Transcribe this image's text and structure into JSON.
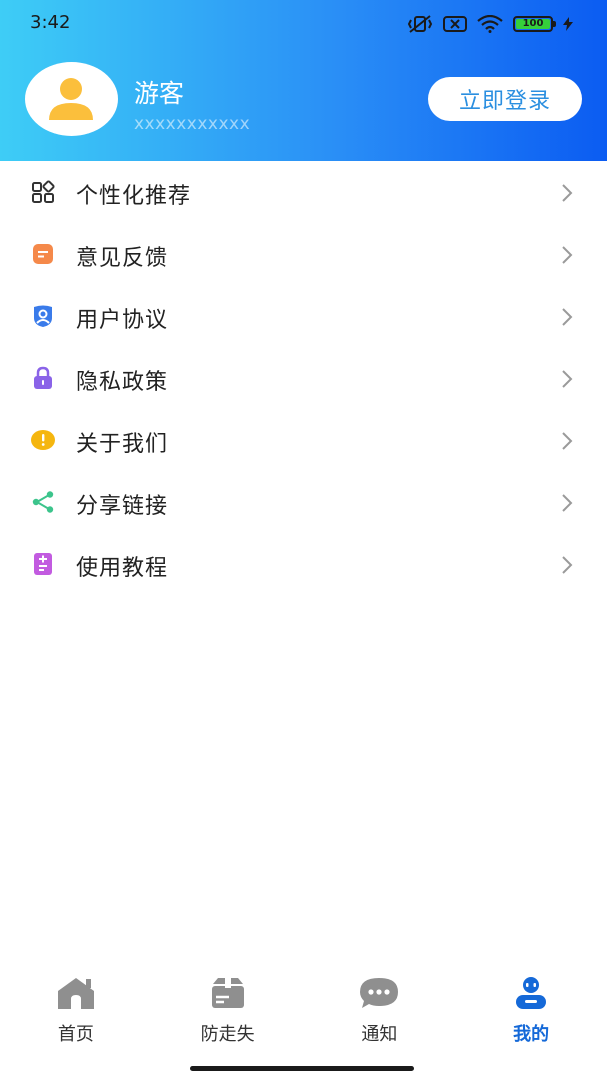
{
  "status_bar": {
    "time": "3:42",
    "battery": "100"
  },
  "profile": {
    "name": "游客",
    "id_masked": "xxxxxxxxxxx",
    "login_label": "立即登录"
  },
  "menu": [
    {
      "label": "个性化推荐",
      "icon": "grid-icon",
      "color": "#333333"
    },
    {
      "label": "意见反馈",
      "icon": "feedback-icon",
      "color": "#f5894a"
    },
    {
      "label": "用户协议",
      "icon": "user-shield-icon",
      "color": "#3a7bea"
    },
    {
      "label": "隐私政策",
      "icon": "lock-icon",
      "color": "#8a63e8"
    },
    {
      "label": "关于我们",
      "icon": "info-icon",
      "color": "#f5b60f"
    },
    {
      "label": "分享链接",
      "icon": "share-icon",
      "color": "#3cc48c"
    },
    {
      "label": "使用教程",
      "icon": "tutorial-icon",
      "color": "#c25be0"
    }
  ],
  "tabs": [
    {
      "label": "首页",
      "icon": "home-icon",
      "active": false
    },
    {
      "label": "防走失",
      "icon": "id-card-icon",
      "active": false
    },
    {
      "label": "通知",
      "icon": "chat-icon",
      "active": false
    },
    {
      "label": "我的",
      "icon": "profile-icon",
      "active": true
    }
  ],
  "colors": {
    "header_gradient_start": "#3ecdf6",
    "header_gradient_end": "#0b5cf2",
    "active_tab": "#1569d8",
    "inactive_tab_icon": "#8f8f8f"
  }
}
